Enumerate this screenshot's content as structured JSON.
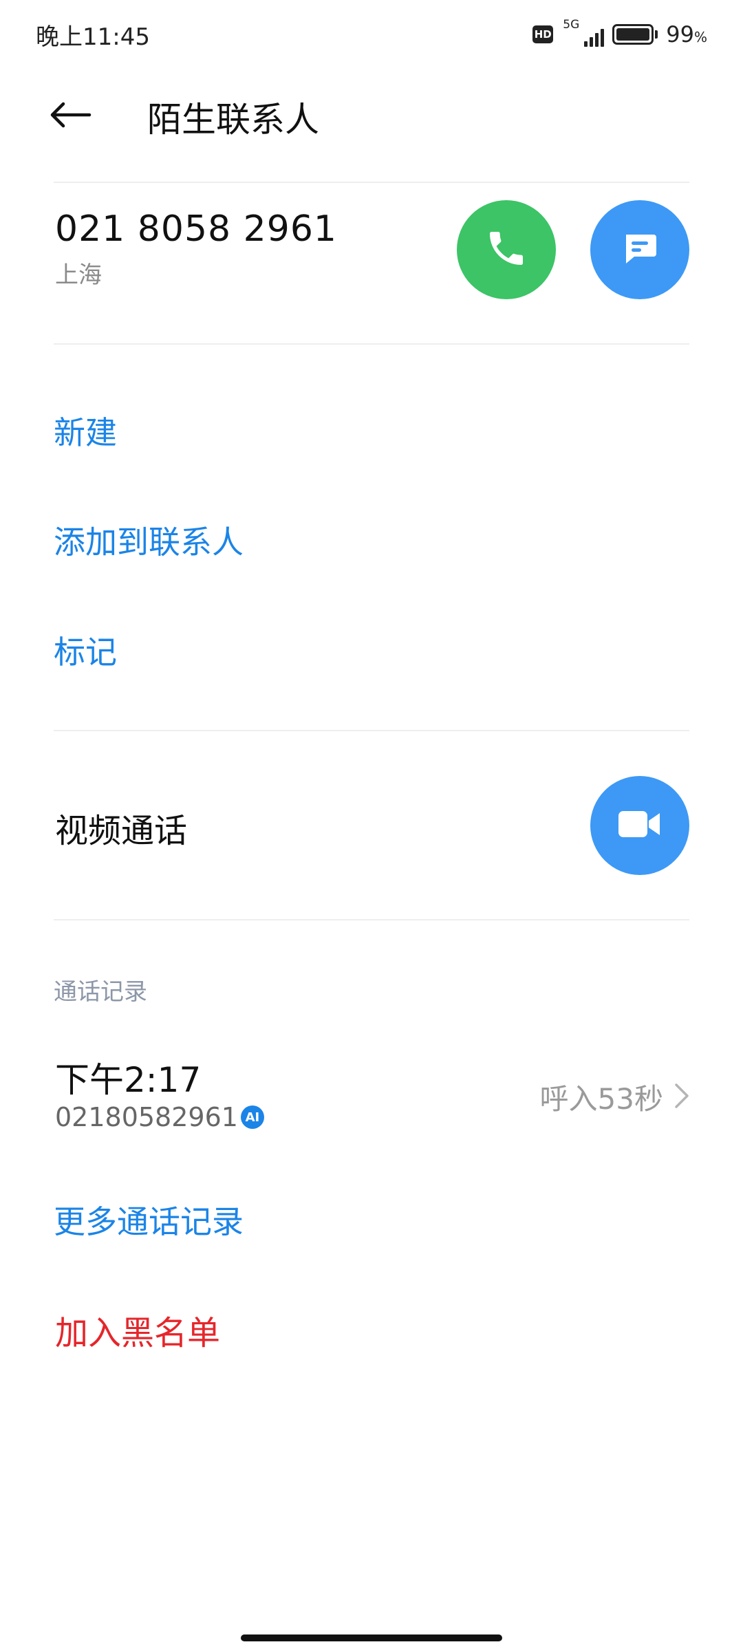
{
  "status_bar": {
    "time": "晚上11:45",
    "hd_label": "HD",
    "network": "5G",
    "battery_level": 0.99,
    "battery_percent": "99",
    "battery_unit": "%"
  },
  "header": {
    "title": "陌生联系人",
    "back_icon": "arrow-left-icon"
  },
  "contact": {
    "number": "021 8058 2961",
    "location": "上海",
    "call_color": "#3cc466",
    "message_color": "#3d99f5"
  },
  "actions": {
    "new_label": "新建",
    "add_to_contacts_label": "添加到联系人",
    "mark_label": "标记"
  },
  "video_call": {
    "label": "视频通话",
    "button_color": "#3d99f5"
  },
  "call_log": {
    "section_title": "通话记录",
    "entries": [
      {
        "time": "下午2:17",
        "number": "02180582961",
        "badge": "AI",
        "status": "呼入53秒"
      }
    ],
    "more_label": "更多通话记录"
  },
  "blacklist": {
    "label": "加入黑名单",
    "color": "#e5262b"
  },
  "accent_color": "#1b84e7"
}
